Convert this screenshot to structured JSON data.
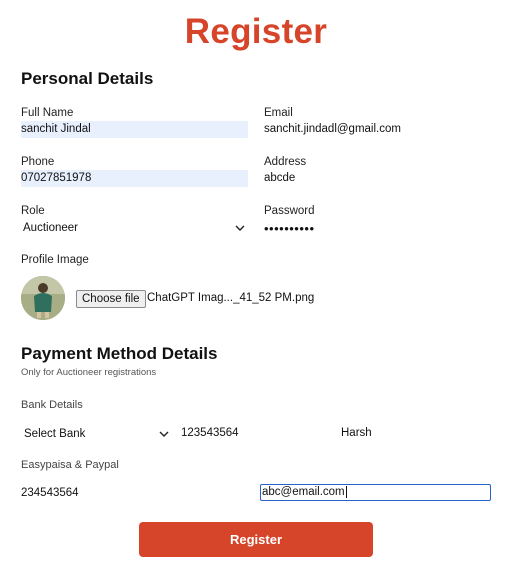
{
  "page": {
    "title": "Register"
  },
  "personal": {
    "heading": "Personal Details",
    "full_name": {
      "label": "Full Name",
      "value": "sanchit Jindal"
    },
    "email": {
      "label": "Email",
      "value": "sanchit.jindadl@gmail.com"
    },
    "phone": {
      "label": "Phone",
      "value": "07027851978"
    },
    "address": {
      "label": "Address",
      "value": "abcde"
    },
    "role": {
      "label": "Role",
      "value": "Auctioneer"
    },
    "password": {
      "label": "Password",
      "value": "••••••••••"
    },
    "profile_image": {
      "label": "Profile Image",
      "button": "Choose file",
      "file_name": "ChatGPT Imag..._41_52 PM.png"
    }
  },
  "payment": {
    "heading": "Payment Method Details",
    "subtitle": "Only for Auctioneer registrations",
    "bank_details_label": "Bank Details",
    "bank_select": "Select Bank",
    "account_number": "123543564",
    "account_name": "Harsh",
    "easypaisa_label": "Easypaisa & Paypal",
    "easypaisa_number": "234543564",
    "paypal_email": "abc@email.com"
  },
  "submit": {
    "label": "Register"
  },
  "colors": {
    "accent": "#d6452a",
    "autofill": "#e8f0fe",
    "focus": "#2563c9"
  },
  "icons": {
    "role_select": "chevron-down-icon",
    "bank_select": "chevron-down-icon",
    "avatar": "profile-avatar"
  }
}
